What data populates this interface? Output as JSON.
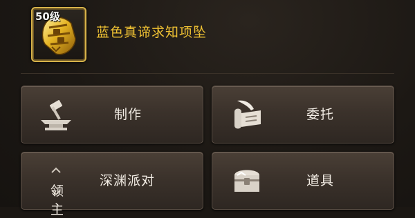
{
  "item": {
    "level": "50级",
    "name": "蓝色真谛求知项坠",
    "icon": "golden-pendant-icon",
    "name_color": "#f0c233"
  },
  "actions": [
    {
      "label": "制作",
      "icon": "anvil-hammer-icon"
    },
    {
      "label": "委托",
      "icon": "scroll-quill-icon"
    },
    {
      "label": "深渊派对",
      "icon": "lord-badge-icon",
      "icon_text": "领主"
    },
    {
      "label": "道具",
      "icon": "treasure-chest-icon"
    }
  ]
}
